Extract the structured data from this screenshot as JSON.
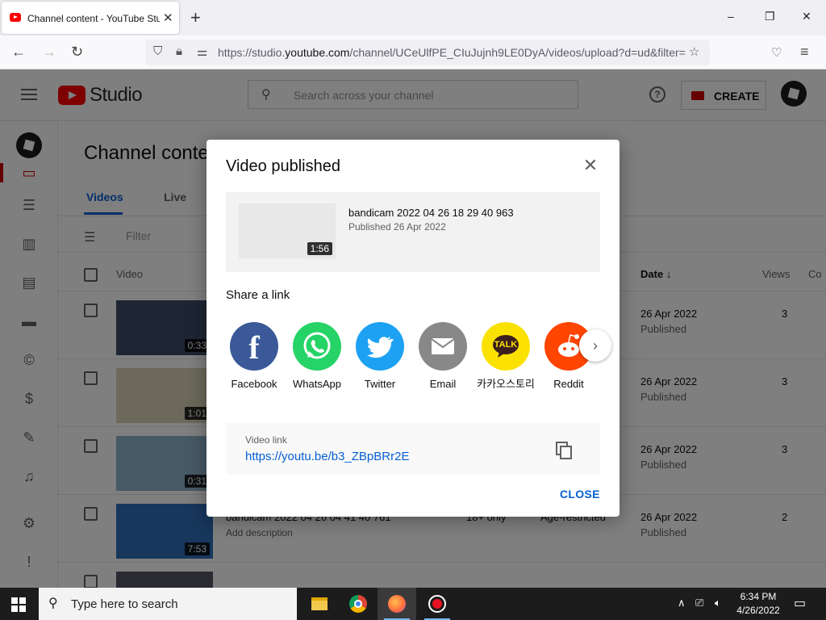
{
  "browser": {
    "tab_title": "Channel content - YouTube Studio",
    "tab_close": "✕",
    "new_tab": "+",
    "url_prefix": "https://studio.",
    "url_host": "youtube.com",
    "url_rest": "/channel/UCeUlfPE_CIuJujnh9LE0DyA/videos/upload?d=ud&filter=",
    "window_controls": [
      "–",
      "❐",
      "✕"
    ]
  },
  "studio": {
    "logo_text": "Studio",
    "search_placeholder": "Search across your channel",
    "help_label": "?",
    "create_label": "CREATE",
    "page_title": "Channel content",
    "tabs": [
      "Videos",
      "Live"
    ],
    "filter_placeholder": "Filter",
    "table_headers": {
      "video": "Video",
      "date": "Date",
      "date_sort": "↓",
      "views": "Views",
      "comments": "Co"
    },
    "rows": [
      {
        "duration": "0:33",
        "date": "26 Apr 2022",
        "status": "Published",
        "views": "3",
        "title": "",
        "description": "",
        "visibility": "",
        "restriction": ""
      },
      {
        "duration": "1:01",
        "date": "26 Apr 2022",
        "status": "Published",
        "views": "3",
        "title": "",
        "description": "",
        "visibility": "",
        "restriction": ""
      },
      {
        "duration": "0:31",
        "date": "26 Apr 2022",
        "status": "Published",
        "views": "3",
        "title": "",
        "description": "",
        "visibility": "",
        "restriction": ""
      },
      {
        "duration": "7:53",
        "date": "26 Apr 2022",
        "status": "Published",
        "views": "2",
        "title": "bandicam 2022 04 26 04 41 40 761",
        "description": "Add description",
        "visibility": "18+ only",
        "restriction": "Age-restricted"
      }
    ]
  },
  "dialog": {
    "title": "Video published",
    "close_icon": "✕",
    "video": {
      "duration": "1:56",
      "name": "bandicam 2022 04 26 18 29 40 963",
      "published": "Published 26 Apr 2022"
    },
    "share_heading": "Share a link",
    "share_targets": [
      {
        "label": "Facebook",
        "icon": "facebook-icon"
      },
      {
        "label": "WhatsApp",
        "icon": "whatsapp-icon"
      },
      {
        "label": "Twitter",
        "icon": "twitter-icon"
      },
      {
        "label": "Email",
        "icon": "email-icon"
      },
      {
        "label": "카카오스토리",
        "icon": "kakao-talk-icon",
        "badge": "TALK"
      },
      {
        "label": "Reddit",
        "icon": "reddit-icon"
      }
    ],
    "next_arrow": "›",
    "link_label": "Video link",
    "link_url": "https://youtu.be/b3_ZBpBRr2E",
    "close_button": "CLOSE"
  },
  "taskbar": {
    "search_placeholder": "Type here to search",
    "time": "6:34 PM",
    "date": "4/26/2022"
  },
  "colors": {
    "accent_blue": "#065fd4",
    "youtube_red": "#ff0000",
    "facebook": "#3b5998",
    "whatsapp": "#25d366",
    "twitter": "#1da1f2",
    "email": "#888888",
    "kakao": "#fae100",
    "reddit": "#ff4500"
  }
}
